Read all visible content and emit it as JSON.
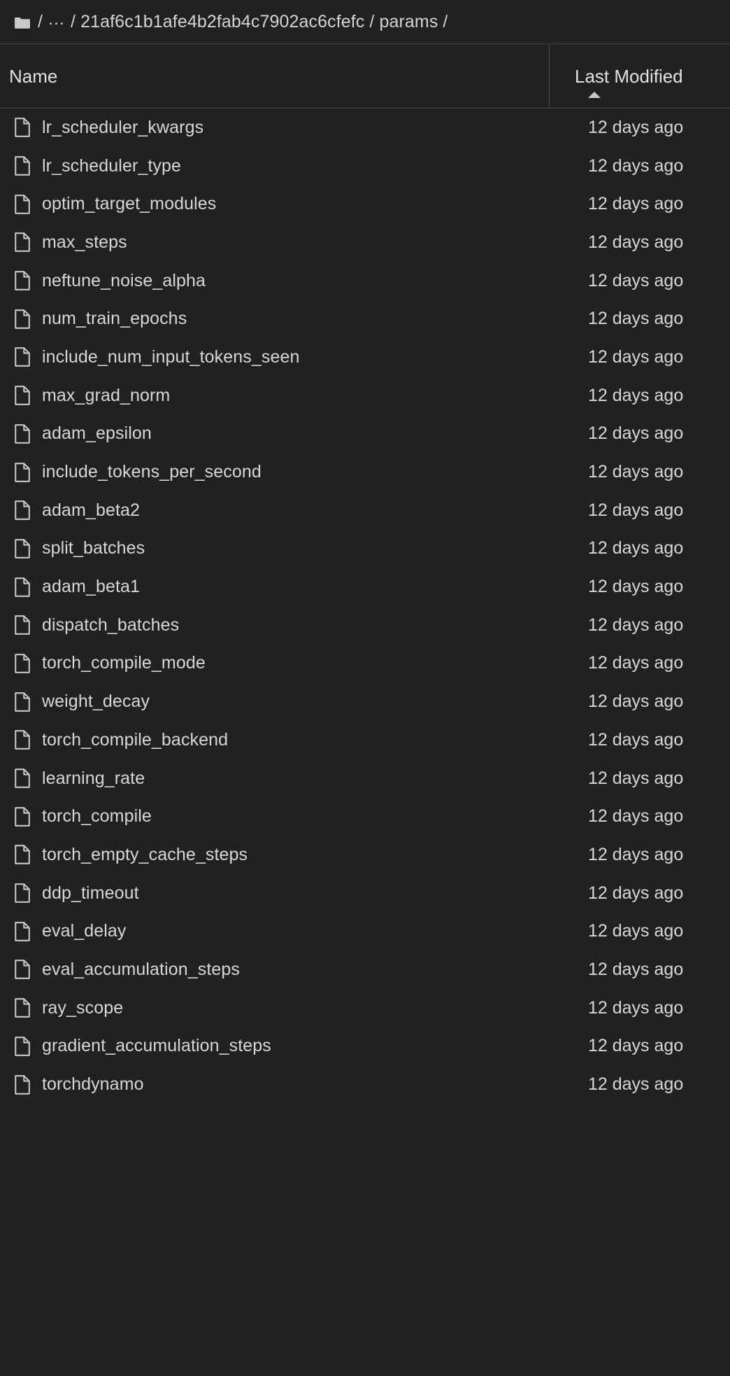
{
  "theme": {
    "background": "#212121",
    "text": "#d7d7d7",
    "border": "#3f3f3f",
    "divider": "#4a4a4a",
    "icon": "#c8c8c8"
  },
  "breadcrumb": {
    "home_icon": "folder-icon",
    "separator": "/",
    "ellipsis": "…",
    "items": [
      "21af6c1b1afe4b2fab4c7902ac6cfefc",
      "params"
    ]
  },
  "columns": {
    "name": "Name",
    "last_modified": "Last Modified",
    "sort_column": "Last Modified",
    "sort_direction": "ascending",
    "sort_icon": "caret-up-icon"
  },
  "files": [
    {
      "name": "lr_scheduler_kwargs",
      "modified": "12 days ago",
      "icon": "file-icon"
    },
    {
      "name": "lr_scheduler_type",
      "modified": "12 days ago",
      "icon": "file-icon"
    },
    {
      "name": "optim_target_modules",
      "modified": "12 days ago",
      "icon": "file-icon"
    },
    {
      "name": "max_steps",
      "modified": "12 days ago",
      "icon": "file-icon"
    },
    {
      "name": "neftune_noise_alpha",
      "modified": "12 days ago",
      "icon": "file-icon"
    },
    {
      "name": "num_train_epochs",
      "modified": "12 days ago",
      "icon": "file-icon"
    },
    {
      "name": "include_num_input_tokens_seen",
      "modified": "12 days ago",
      "icon": "file-icon"
    },
    {
      "name": "max_grad_norm",
      "modified": "12 days ago",
      "icon": "file-icon"
    },
    {
      "name": "adam_epsilon",
      "modified": "12 days ago",
      "icon": "file-icon"
    },
    {
      "name": "include_tokens_per_second",
      "modified": "12 days ago",
      "icon": "file-icon"
    },
    {
      "name": "adam_beta2",
      "modified": "12 days ago",
      "icon": "file-icon"
    },
    {
      "name": "split_batches",
      "modified": "12 days ago",
      "icon": "file-icon"
    },
    {
      "name": "adam_beta1",
      "modified": "12 days ago",
      "icon": "file-icon"
    },
    {
      "name": "dispatch_batches",
      "modified": "12 days ago",
      "icon": "file-icon"
    },
    {
      "name": "torch_compile_mode",
      "modified": "12 days ago",
      "icon": "file-icon"
    },
    {
      "name": "weight_decay",
      "modified": "12 days ago",
      "icon": "file-icon"
    },
    {
      "name": "torch_compile_backend",
      "modified": "12 days ago",
      "icon": "file-icon"
    },
    {
      "name": "learning_rate",
      "modified": "12 days ago",
      "icon": "file-icon"
    },
    {
      "name": "torch_compile",
      "modified": "12 days ago",
      "icon": "file-icon"
    },
    {
      "name": "torch_empty_cache_steps",
      "modified": "12 days ago",
      "icon": "file-icon"
    },
    {
      "name": "ddp_timeout",
      "modified": "12 days ago",
      "icon": "file-icon"
    },
    {
      "name": "eval_delay",
      "modified": "12 days ago",
      "icon": "file-icon"
    },
    {
      "name": "eval_accumulation_steps",
      "modified": "12 days ago",
      "icon": "file-icon"
    },
    {
      "name": "ray_scope",
      "modified": "12 days ago",
      "icon": "file-icon"
    },
    {
      "name": "gradient_accumulation_steps",
      "modified": "12 days ago",
      "icon": "file-icon"
    },
    {
      "name": "torchdynamo",
      "modified": "12 days ago",
      "icon": "file-icon"
    }
  ]
}
